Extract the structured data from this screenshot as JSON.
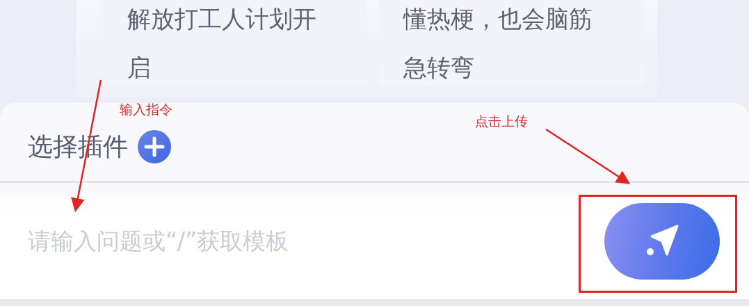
{
  "suggestion_cards": [
    {
      "text": "解放打工人计划开启"
    },
    {
      "text": "懂热梗，也会脑筋急转弯"
    }
  ],
  "plugin_bar": {
    "label": "选择插件"
  },
  "input": {
    "placeholder": "请输入问题或“/”获取模板"
  },
  "annotations": [
    {
      "kind": "label",
      "text": "输入指令"
    },
    {
      "kind": "label",
      "text": "点击上传"
    }
  ]
}
